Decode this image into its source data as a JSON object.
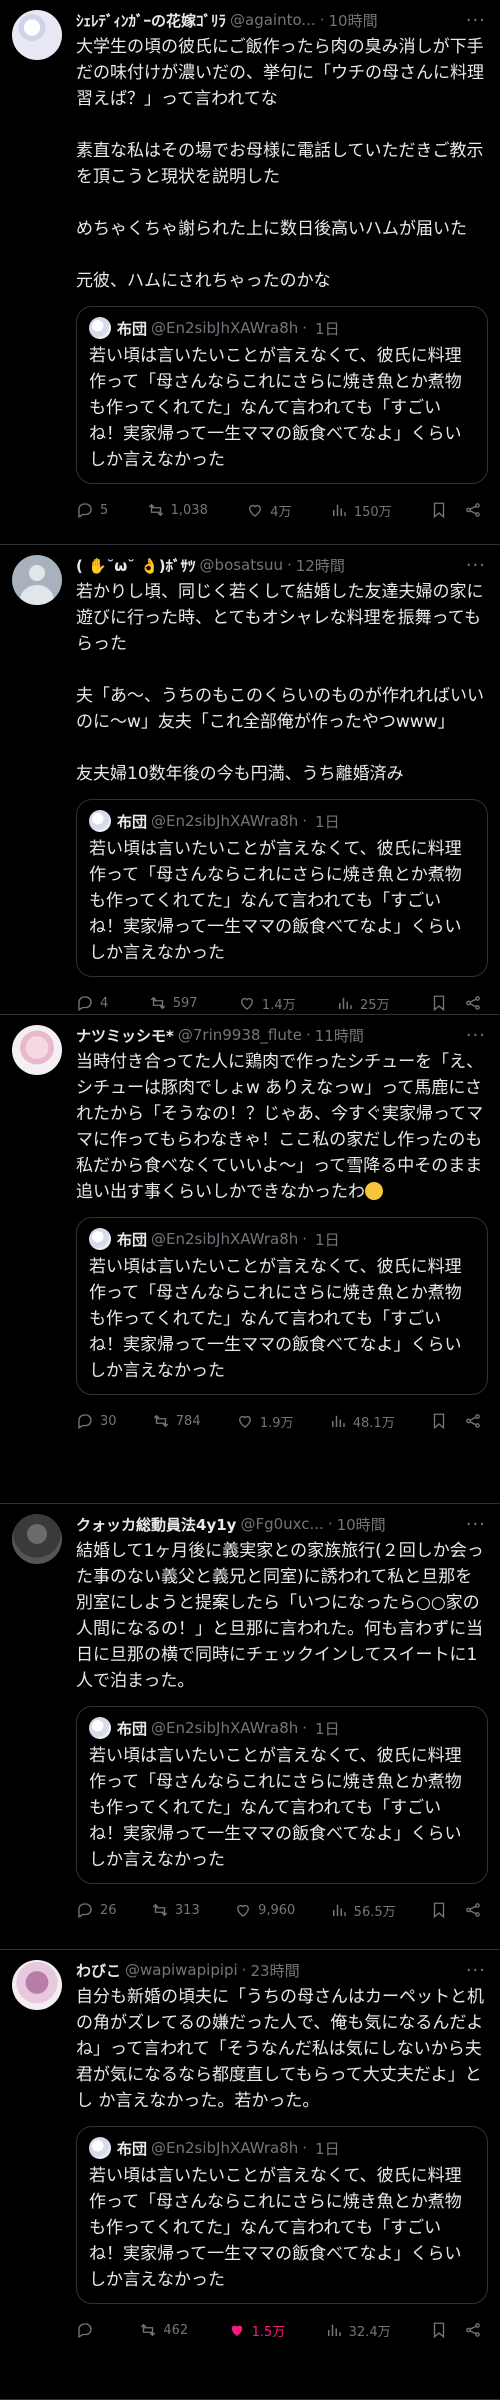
{
  "tweets": [
    {
      "name": "ｼｪﾚﾃﾞｨﾝｶﾞｰの花嫁ｺﾞﾘﾗ",
      "handle": "@againto...",
      "time": "10時間",
      "body": "大学生の頃の彼氏にご飯作ったら肉の臭み消しが下手だの味付けが濃いだの、挙句に「ウチの母さんに料理習えば？」って言われてな\n\n素直な私はその場でお母様に電話していただきご教示を頂こうと現状を説明した\n\nめちゃくちゃ謝られた上に数日後高いハムが届いた\n\n元彼、ハムにされちゃったのかな",
      "replies": "5",
      "reposts": "1,038",
      "likes": "4万",
      "views": "150万"
    },
    {
      "name": "( ✋˘ω˘ 👌)ﾎﾞｻﾂ",
      "handle": "@bosatsuu",
      "time": "12時間",
      "body": "若かりし頃、同じく若くして結婚した友達夫婦の家に遊びに行った時、とてもオシャレな料理を振舞ってもらった\n\n夫「あ〜、うちのもこのくらいのものが作れればいいのに〜w」友夫「これ全部俺が作ったやつwww」\n\n友夫婦10数年後の今も円満、うち離婚済み",
      "replies": "4",
      "reposts": "597",
      "likes": "1.4万",
      "views": "25万"
    },
    {
      "name": "ナツミッシモ*",
      "handle": "@7rin9938_flute",
      "time": "11時間",
      "body": "当時付き合ってた人に鶏肉で作ったシチューを「え、シチューは豚肉でしょw ありえなっw」って馬鹿にされたから「そうなの！？じゃあ、今すぐ実家帰ってママに作ってもらわなきゃ！ここ私の家だし作ったのも私だから食べなくていいよ〜」って雪降る中そのまま追い出す事くらいしかできなかったわ",
      "replies": "30",
      "reposts": "784",
      "likes": "1.9万",
      "views": "48.1万"
    },
    {
      "name": "クォッカ総動員法4y1y",
      "handle": "@Fg0uxc...",
      "time": "10時間",
      "body": "結婚して1ヶ月後に義実家との家族旅行(２回しか会った事のない義父と義兄と同室)に誘われて私と旦那を別室にしようと提案したら「いつになったら○○家の人間になるの！」と旦那に言われた。何も言わずに当日に旦那の横で同時にチェックインしてスイートに1人で泊まった。",
      "replies": "26",
      "reposts": "313",
      "likes": "9,960",
      "views": "56.5万"
    },
    {
      "name": "わびこ",
      "handle": "@wapiwapipipi",
      "time": "23時間",
      "body": "自分も新婚の頃夫に「うちの母さんはカーペットと机の角がズレてるの嫌だった人で、俺も気になるんだよね」って言われて「そうなんだ私は気にしないから夫君が気になるなら都度直してもらって大丈夫だよ」とし か言えなかった。若かった。",
      "replies": "",
      "reposts": "462",
      "likes": "1.5万",
      "views": "32.4万"
    }
  ],
  "quote": {
    "name": "布団",
    "handle": "@En2sibJhXAWra8h",
    "time": "1日",
    "body": "若い頃は言いたいことが言えなくて、彼氏に料理作って「母さんならこれにさらに焼き魚とか煮物も作ってくれてた」なんて言われても「すごいね！実家帰って一生ママの飯食べてなよ」くらいしか言えなかった"
  },
  "icons": [
    "reply-icon",
    "repost-icon",
    "like-icon",
    "views-icon",
    "bookmark-icon",
    "share-icon",
    "more-icon"
  ],
  "colors": {
    "background": "#000000",
    "text": "#e7e9ea",
    "muted": "#71767b",
    "border": "#2f3336",
    "like": "#f91880"
  }
}
